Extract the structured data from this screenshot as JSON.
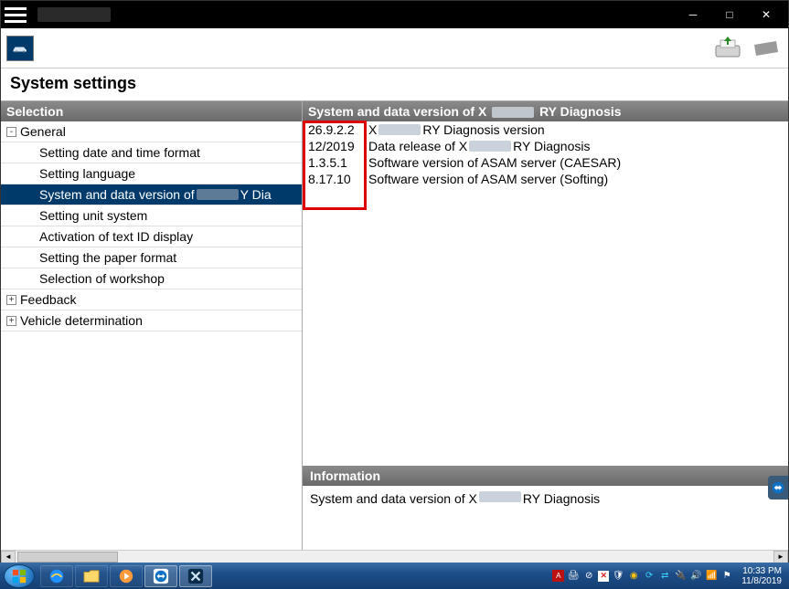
{
  "page_title": "System settings",
  "left_header": "Selection",
  "right_header_prefix": "System and data version of X",
  "right_header_suffix": "RY Diagnosis",
  "info_header": "Information",
  "info_body_prefix": "System and data version of X",
  "info_body_suffix": "RY Diagnosis",
  "tree": {
    "general": "General",
    "items": [
      "Setting date and time format",
      "Setting language"
    ],
    "selected_prefix": "System and data version of ",
    "selected_suffix": "Y Dia",
    "items2": [
      "Setting unit system",
      "Activation of text ID display",
      "Setting the paper format",
      "Selection of workshop"
    ],
    "feedback": "Feedback",
    "vehicle_det": "Vehicle determination"
  },
  "values": [
    {
      "key": "26.9.2.2",
      "label_prefix": "X",
      "label_suffix": "RY Diagnosis version",
      "blur": true
    },
    {
      "key": "12/2019",
      "label_prefix": "Data release of X",
      "label_suffix": "RY Diagnosis",
      "blur": true
    },
    {
      "key": "1.3.5.1",
      "label_prefix": "Software version of ASAM server (CAESAR)",
      "label_suffix": "",
      "blur": false
    },
    {
      "key": "8.17.10",
      "label_prefix": "Software version of ASAM server (Softing)",
      "label_suffix": "",
      "blur": false
    }
  ],
  "clock": {
    "time": "10:33 PM",
    "date": "11/8/2019"
  }
}
